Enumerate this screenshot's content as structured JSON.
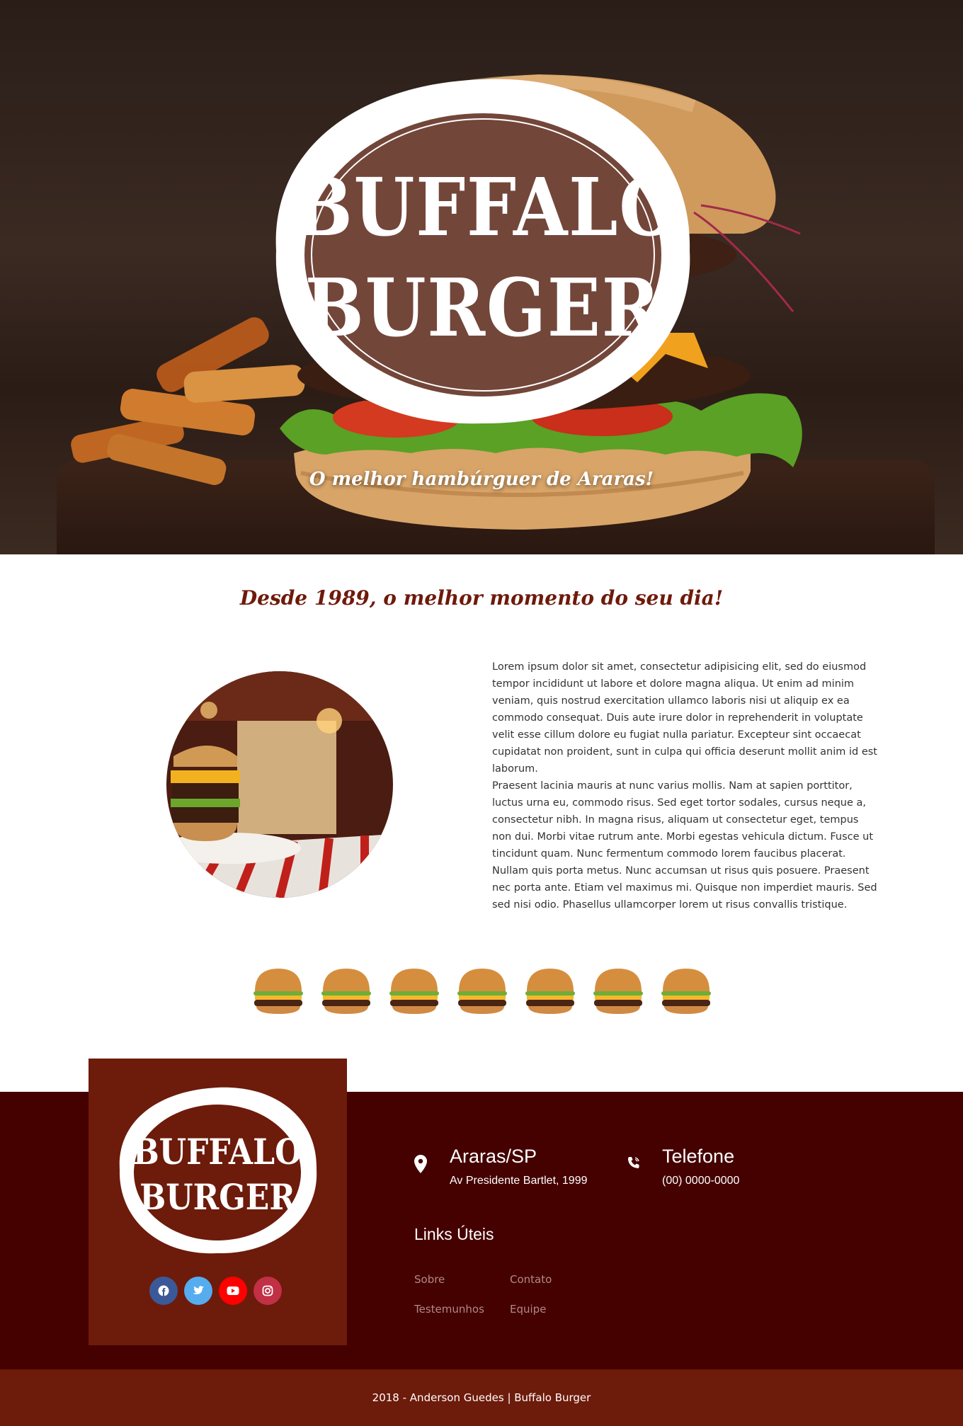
{
  "hero": {
    "logo_line1": "BUFFALO",
    "logo_line2": "BURGER",
    "tagline": "O melhor hambúrguer de Araras!"
  },
  "about": {
    "title": "Desde 1989, o melhor momento do seu dia!",
    "paragraph1": "Lorem ipsum dolor sit amet, consectetur adipisicing elit, sed do eiusmod tempor incididunt ut labore et dolore magna aliqua. Ut enim ad minim veniam, quis nostrud exercitation ullamco laboris nisi ut aliquip ex ea commodo consequat. Duis aute irure dolor in reprehenderit in voluptate velit esse cillum dolore eu fugiat nulla pariatur. Excepteur sint occaecat cupidatat non proident, sunt in culpa qui officia deserunt mollit anim id est laborum.",
    "paragraph2": "Praesent lacinia mauris at nunc varius mollis. Nam at sapien porttitor, luctus urna eu, commodo risus. Sed eget tortor sodales, cursus neque a, consectetur nibh. In magna risus, aliquam ut consectetur eget, tempus non dui. Morbi vitae rutrum ante. Morbi egestas vehicula dictum. Fusce ut tincidunt quam. Nunc fermentum commodo lorem faucibus placerat. Nullam quis porta metus. Nunc accumsan ut risus quis posuere. Praesent nec porta ante. Etiam vel maximus mi. Quisque non imperdiet mauris. Sed sed nisi odio. Phasellus ullamcorper lorem ut risus convallis tristique."
  },
  "footer": {
    "logo_line1": "BUFFALO",
    "logo_line2": "BURGER",
    "location": {
      "title": "Araras/SP",
      "address": "Av Presidente Bartlet, 1999",
      "icon": "map-pin-icon"
    },
    "phone": {
      "title": "Telefone",
      "number": "(00) 0000-0000",
      "icon": "phone-icon"
    },
    "links_title": "Links Úteis",
    "links": [
      "Sobre",
      "Contato",
      "Testemunhos",
      "Equipe"
    ],
    "social": [
      {
        "icon": "facebook-icon",
        "color": "#3b5998"
      },
      {
        "icon": "twitter-icon",
        "color": "#55acee"
      },
      {
        "icon": "youtube-icon",
        "color": "#ff0000"
      },
      {
        "icon": "instagram-icon",
        "color": "#c13044"
      }
    ],
    "copyright": "2018 - Anderson Guedes | Buffalo Burger"
  },
  "colors": {
    "accent": "#6e1a0b",
    "footer_bg": "#450000",
    "footer_box": "#6d1b0b"
  }
}
